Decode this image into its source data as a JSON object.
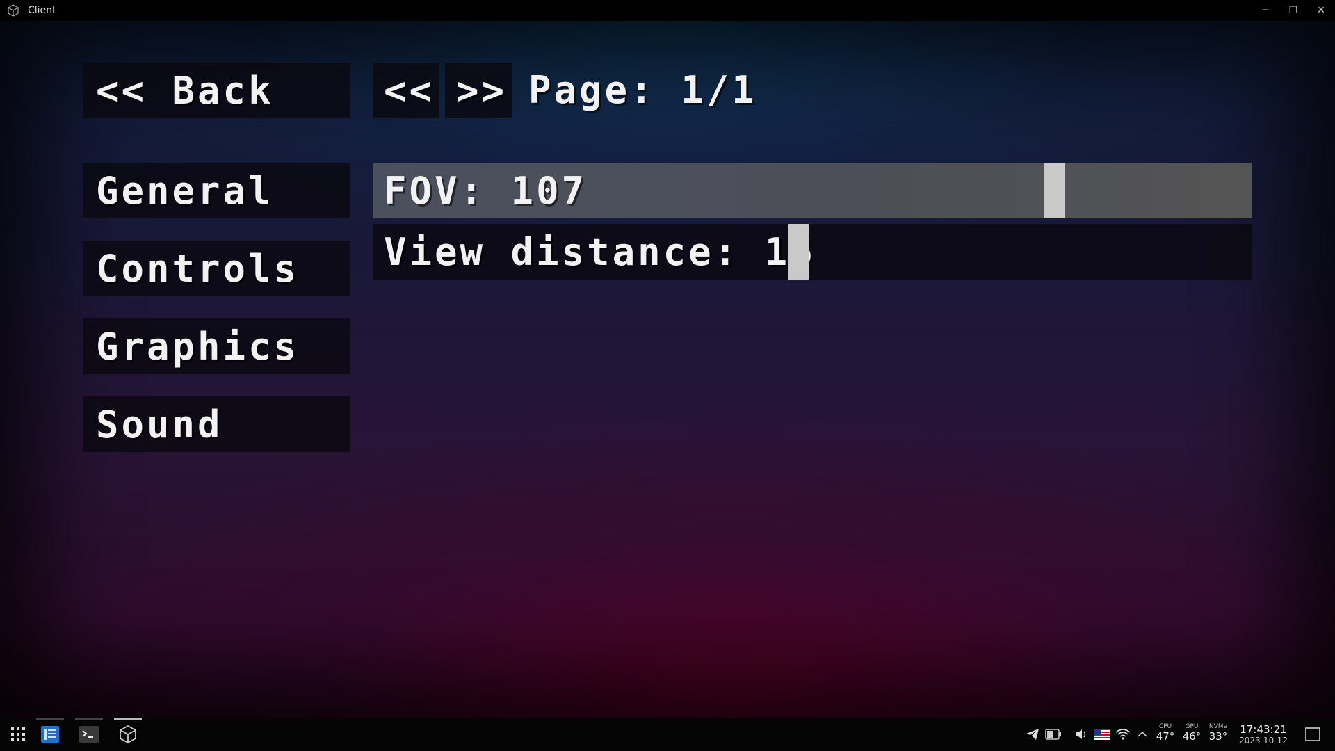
{
  "window": {
    "title": "Client",
    "minimize_glyph": "─",
    "restore_glyph": "❐",
    "close_glyph": "✕"
  },
  "nav": {
    "back_label": "<< Back",
    "prev_page_label": "<<",
    "next_page_label": ">>",
    "page_indicator": "Page: 1/1"
  },
  "categories": [
    {
      "label": "General"
    },
    {
      "label": "Controls"
    },
    {
      "label": "Graphics"
    },
    {
      "label": "Sound"
    }
  ],
  "settings": {
    "fov": {
      "label": "FOV: 107",
      "value": 107,
      "slider_fraction": 0.79
    },
    "view_distance": {
      "label": "View distance: 16",
      "value": 16,
      "slider_fraction": 0.48
    }
  },
  "taskbar": {
    "apps": [
      "launcher-icon",
      "file-manager-icon",
      "terminal-icon",
      "game-client-icon"
    ],
    "tray": {
      "battery_text": "57%",
      "cpu": {
        "label": "CPU",
        "value": "47°"
      },
      "gpu": {
        "label": "GPU",
        "value": "46°"
      },
      "nvme": {
        "label": "NVMe",
        "value": "33°"
      },
      "time": "17:43:21",
      "date": "2023-10-12"
    }
  },
  "colors": {
    "button_bg": "#0a0810",
    "active_slider_bg": "#4a4f5c",
    "knob": "#c9c9c9",
    "text": "#f2f2f2"
  }
}
